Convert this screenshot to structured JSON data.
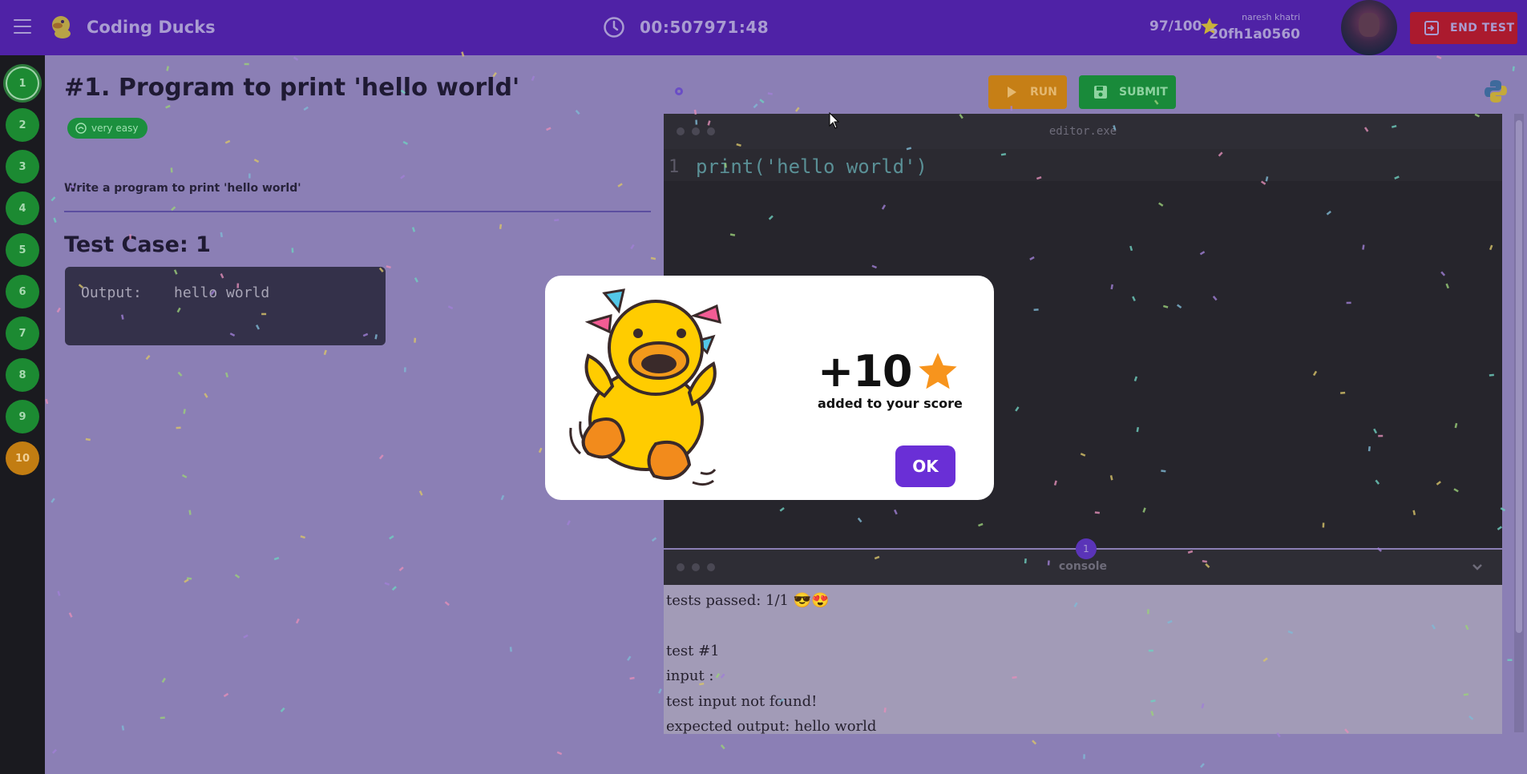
{
  "topbar": {
    "brand": "Coding Ducks",
    "timer": "00:507971:48",
    "score": "97/100",
    "username": "naresh khatri",
    "roll_number": "20fh1a0560",
    "end_test_label": "END TEST"
  },
  "question_nav": {
    "items": [
      "1",
      "2",
      "3",
      "4",
      "5",
      "6",
      "7",
      "8",
      "9",
      "10"
    ]
  },
  "question": {
    "title": "#1. Program to print 'hello world'",
    "difficulty": "very easy",
    "description": "Write a program to print 'hello world'",
    "test_case_title": "Test Case: 1",
    "output_label": "Output:",
    "output_value": "hello world"
  },
  "toolbar": {
    "run_label": "RUN",
    "submit_label": "SUBMIT"
  },
  "editor": {
    "title": "editor.exe",
    "line_number": "1",
    "code": "print('hello world')"
  },
  "console": {
    "title": "console",
    "badge": "1",
    "lines": {
      "passed": "tests passed: 1/1 😎😍",
      "test": "test #1",
      "input": "input :",
      "missing": "test input not found!",
      "expected": "expected  output: hello world"
    }
  },
  "modal": {
    "points": "+10",
    "message": "added to your score",
    "ok_label": "OK"
  },
  "colors": {
    "accent": "#4f22a6",
    "ok_button": "#6a2fd6",
    "star": "#f7941d",
    "success": "#1b8f3e",
    "warning": "#c67f16",
    "danger": "#ab1a2e"
  },
  "icons": [
    "menu-icon",
    "duck-logo",
    "clock-icon",
    "star-icon",
    "avatar",
    "exit-icon",
    "play-icon",
    "save-icon",
    "python-icon",
    "gear-icon",
    "chevron-down-icon",
    "cloud-icon"
  ]
}
